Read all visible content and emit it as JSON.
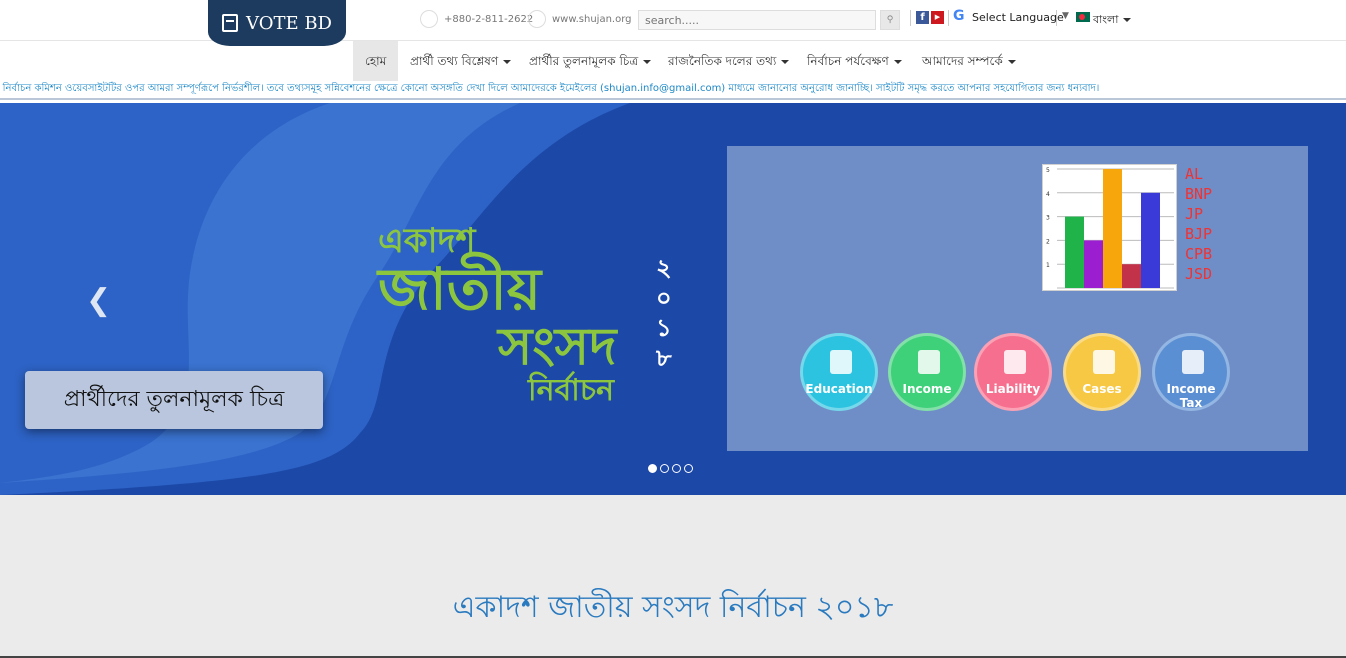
{
  "logo": {
    "text": "VOTE BD"
  },
  "contact": {
    "phone": "+880-2-811-2622",
    "website": "www.shujan.org"
  },
  "search": {
    "placeholder": "search....."
  },
  "translate": {
    "label": "Select Language"
  },
  "language": {
    "selected": "বাংলা"
  },
  "nav": {
    "items": [
      {
        "label": "হোম",
        "active": true
      },
      {
        "label": "প্রার্থী তথ্য বিশ্লেষণ"
      },
      {
        "label": "প্রার্থীর তুলনামূলক চিত্র"
      },
      {
        "label": "রাজনৈতিক দলের তথ্য"
      },
      {
        "label": "নির্বাচন পর্যবেক্ষণ"
      },
      {
        "label": "আমাদের সম্পর্কে"
      }
    ]
  },
  "ticker": {
    "text": "র নির্বাচন কমিশন ওয়েবসাইটটির ওপর আমরা সম্পূর্ণরূপে নির্ভরশীল। তবে তথ্যসমূহ সন্নিবেশনের ক্ষেত্রে কোনো অসঙ্গতি দেখা দিলে আমাদেরকে ইমেইলের (shujan.info@gmail.com) মাধ্যমে জানানোর অনুরোধ জানাচ্ছি। সাইটটি সমৃদ্ধ করতে আপনার সহযোগিতার জন্য ধন্যবাদ।"
  },
  "slide": {
    "caption": "প্রার্থীদের তুলনামূলক চিত্র",
    "heading_line1": "একাদশ",
    "heading_line2": "জাতীয়",
    "heading_line3": "সংসদ",
    "heading_line4": "নির্বাচন",
    "year_digits": [
      "২",
      "০",
      "১",
      "৮"
    ],
    "legend": [
      "AL",
      "BNP",
      "JP",
      "BJP",
      "CPB",
      "JSD"
    ],
    "buttons": [
      {
        "label": "Education",
        "color": "#2cc3e0"
      },
      {
        "label": "Income",
        "color": "#3fd07a"
      },
      {
        "label": "Liability",
        "color": "#f76f8e"
      },
      {
        "label": "Cases",
        "color": "#f7c844"
      },
      {
        "label": "Income Tax",
        "color": "#5b8fd4"
      }
    ]
  },
  "chart_data": {
    "type": "bar",
    "categories": [
      "AL",
      "BNP",
      "JP",
      "BJP",
      "CPB",
      "JSD"
    ],
    "values": [
      3,
      2,
      5,
      1,
      4
    ],
    "colors": [
      "#1fb34a",
      "#9b1fd1",
      "#f7a70b",
      "#c2334a",
      "#3a3ad8"
    ],
    "ylim": [
      0,
      5
    ],
    "tick_labels": [
      "1",
      "2",
      "3",
      "4",
      "5"
    ]
  },
  "section": {
    "heading": "একাদশ জাতীয় সংসদ নির্বাচন ২০১৮"
  }
}
